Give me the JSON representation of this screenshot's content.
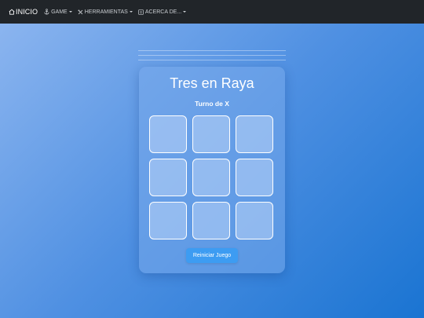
{
  "navbar": {
    "brand_label": "INICIO",
    "brand_icon": "home-icon",
    "items": [
      {
        "label": "GAME",
        "icon": "anchor-icon"
      },
      {
        "label": "HERRAMIENTAS",
        "icon": "tools-icon"
      },
      {
        "label": "ACERCA DE...",
        "icon": "info-box-icon"
      }
    ]
  },
  "game": {
    "title": "Tres en Raya",
    "status": "Turno de X",
    "board": [
      "",
      "",
      "",
      "",
      "",
      "",
      "",
      "",
      ""
    ],
    "reset_label": "Reiniciar Juego"
  },
  "colors": {
    "navbar": "#212529",
    "button": "#3d9cf2",
    "background_start": "#8fb7f0",
    "background_end": "#1a74d2"
  }
}
